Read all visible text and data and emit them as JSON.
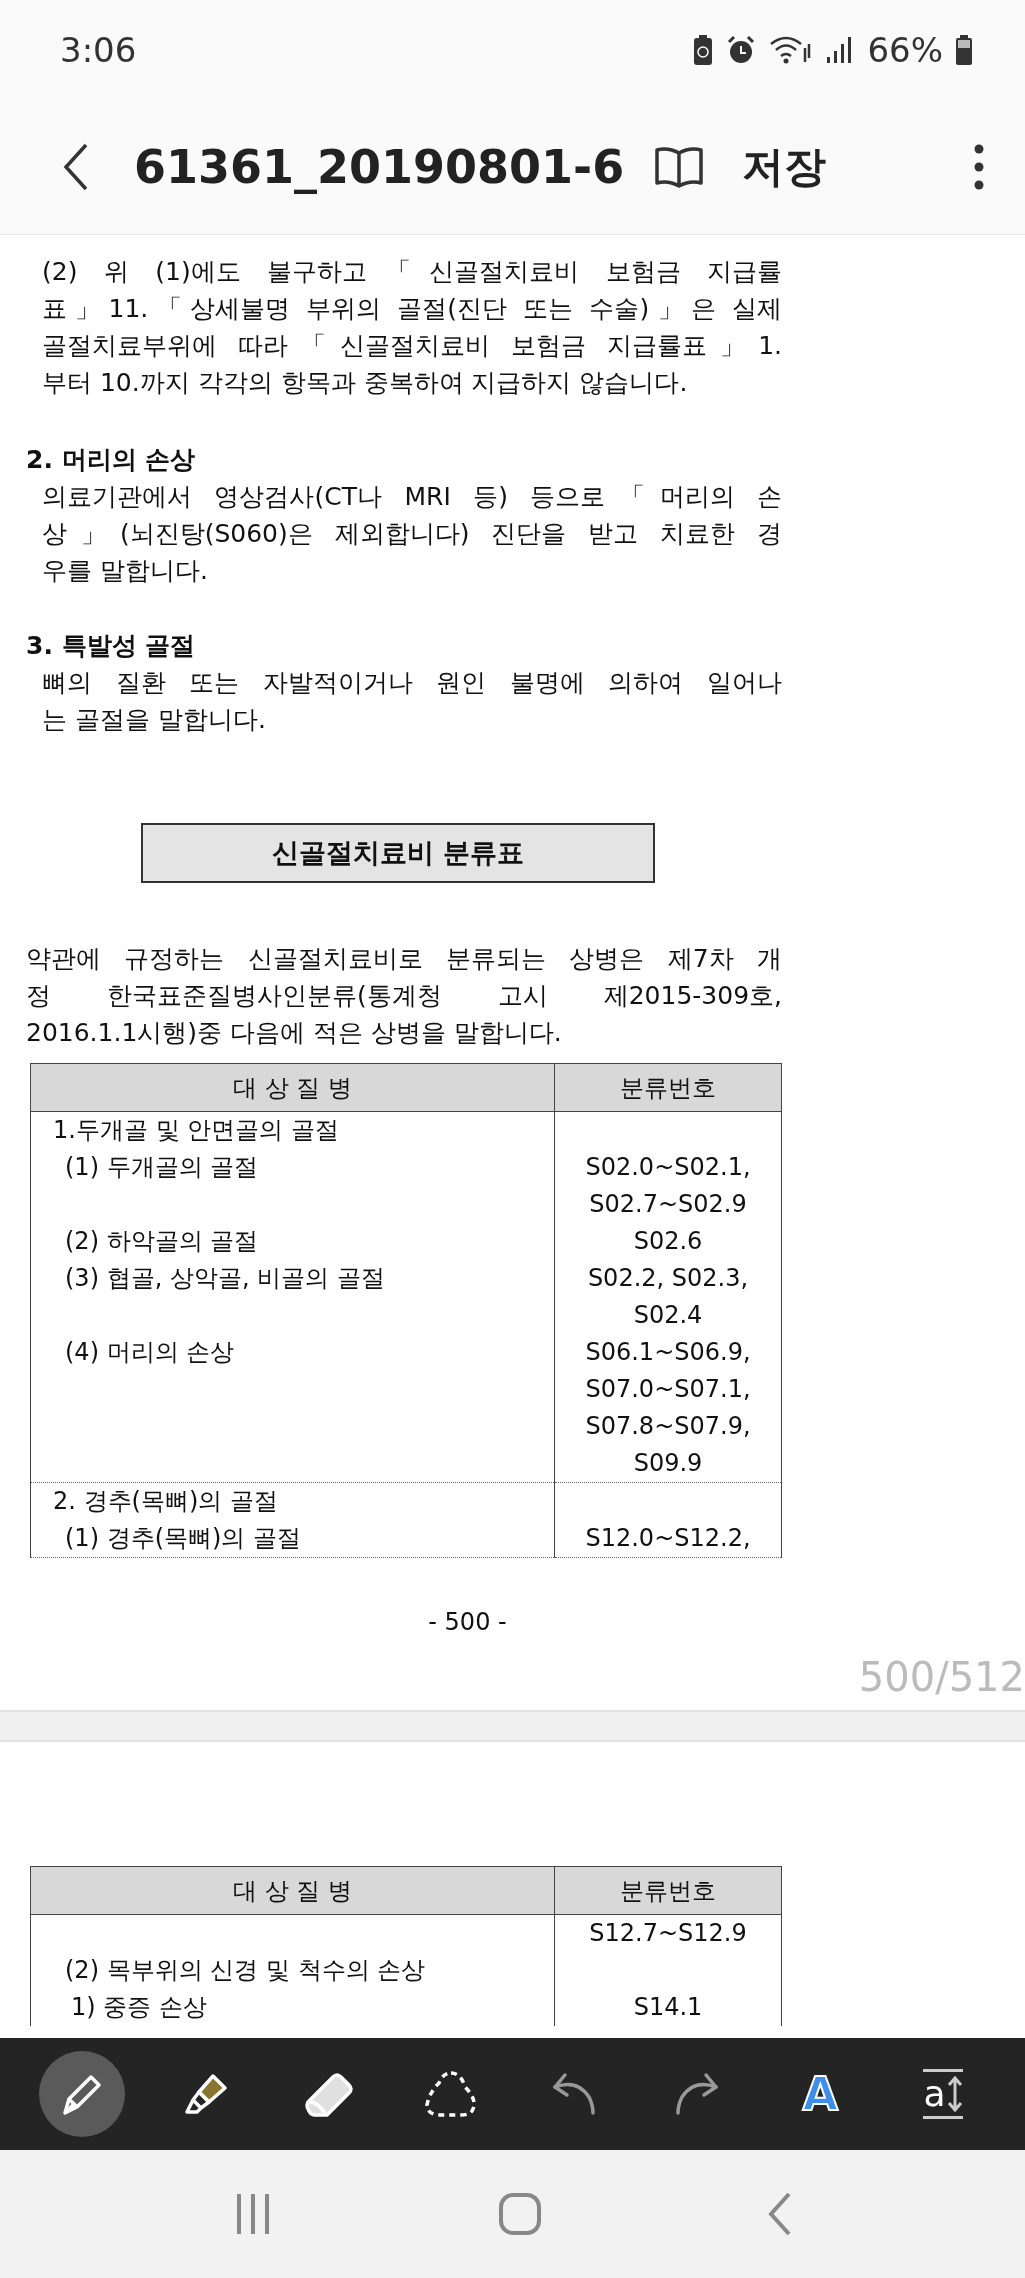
{
  "status_bar": {
    "time": "3:06",
    "battery": "66%"
  },
  "app_bar": {
    "title": "61361_20190801-6",
    "save": "저장"
  },
  "page": {
    "paragraph_lines": [
      "(2) 위 (1)에도 불구하고「신골절치료비 보험금 지급률",
      "표」11.「상세불명 부위의 골절(진단 또는 수술)」은 실제",
      "골절치료부위에 따라「신골절치료비 보험금 지급률표」1.",
      "부터 10.까지 각각의 항목과 중복하여 지급하지 않습니다."
    ],
    "sections": [
      {
        "heading": "2. 머리의 손상",
        "lines": [
          "의료기관에서 영상검사(CT나 MRI 등) 등으로「머리의 손",
          "상」(뇌진탕(S060)은 제외합니다) 진단을 받고 치료한 경",
          "우를 말합니다."
        ]
      },
      {
        "heading": "3. 특발성 골절",
        "lines": [
          "뼈의 질환 또는 자발적이거나 원인 불명에 의하여 일어나",
          "는 골절을 말합니다."
        ]
      }
    ],
    "box_title": "신골절치료비 분류표",
    "intro_lines": [
      "약관에 규정하는 신골절치료비로 분류되는 상병은 제7차 개",
      "정 한국표준질병사인분류(통계청 고시 제2015-309호,",
      "2016.1.1시행)중 다음에 적은 상병을 말합니다."
    ],
    "table": {
      "columns": [
        "대 상 질 병",
        "분류번호"
      ],
      "groups": [
        {
          "rows": [
            {
              "kind": "heading",
              "disease": "1.두개골 및 안면골의 골절",
              "codes": []
            },
            {
              "kind": "item",
              "disease": "(1) 두개골의 골절",
              "codes": [
                "S02.0~S02.1,",
                "S02.7~S02.9"
              ]
            },
            {
              "kind": "item",
              "disease": "(2) 하악골의 골절",
              "codes": [
                "S02.6"
              ]
            },
            {
              "kind": "item",
              "disease": "(3) 협골, 상악골, 비골의 골절",
              "codes": [
                "S02.2, S02.3,",
                "S02.4"
              ]
            },
            {
              "kind": "item",
              "disease": "(4) 머리의 손상",
              "codes": [
                "S06.1~S06.9,",
                "S07.0~S07.1,",
                "S07.8~S07.9,",
                "S09.9"
              ]
            }
          ]
        },
        {
          "rows": [
            {
              "kind": "heading",
              "disease": "2. 경추(목뼈)의 골절",
              "codes": []
            },
            {
              "kind": "item",
              "disease": "(1) 경추(목뼈)의 골절",
              "codes": [
                "S12.0~S12.2,"
              ]
            }
          ]
        }
      ]
    },
    "page_number": "- 500 -"
  },
  "page_indicator": "500/512",
  "next_page": {
    "table": {
      "columns": [
        "대 상 질 병",
        "분류번호"
      ],
      "rows": [
        {
          "kind": "item",
          "disease": "",
          "codes": [
            "S12.7~S12.9"
          ]
        },
        {
          "kind": "item",
          "disease": "(2) 목부위의 신경 및 척수의 손상",
          "codes": []
        },
        {
          "kind": "subitem",
          "disease": "1) 중증 손상",
          "codes": [
            "S14.1"
          ]
        }
      ]
    }
  },
  "toolbar": [
    {
      "kind": "pen",
      "selected": true
    },
    {
      "kind": "highlighter",
      "selected": false
    },
    {
      "kind": "eraser",
      "selected": false
    },
    {
      "kind": "lasso",
      "selected": false
    },
    {
      "kind": "undo",
      "selected": false
    },
    {
      "kind": "redo",
      "selected": false
    },
    {
      "kind": "text",
      "selected": false,
      "label": "A"
    },
    {
      "kind": "textsize",
      "selected": false,
      "label": "a"
    }
  ]
}
